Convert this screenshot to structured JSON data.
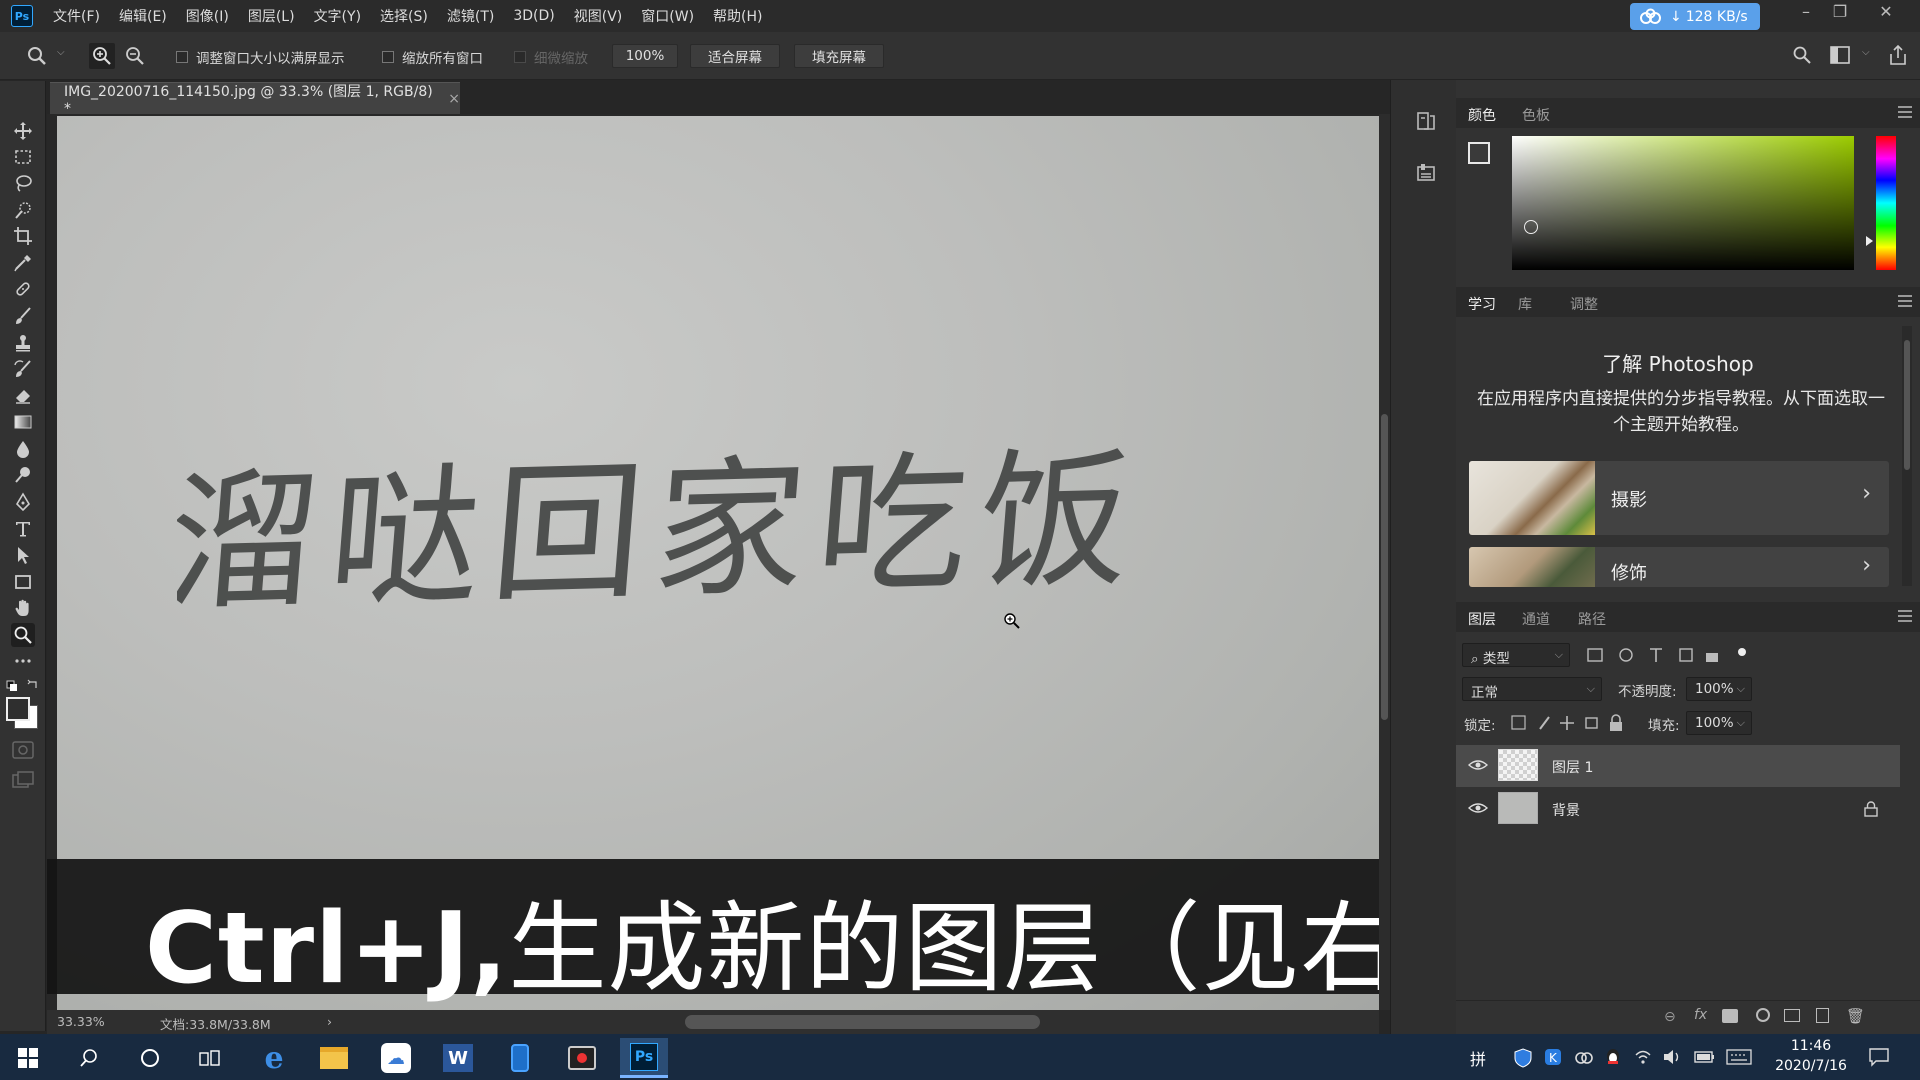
{
  "menubar": {
    "app_icon": "Ps",
    "items": [
      "文件(F)",
      "编辑(E)",
      "图像(I)",
      "图层(L)",
      "文字(Y)",
      "选择(S)",
      "滤镜(T)",
      "3D(D)",
      "视图(V)",
      "窗口(W)",
      "帮助(H)"
    ],
    "net_speed": "128 KB/s"
  },
  "options": {
    "resize_window": "调整窗口大小以满屏显示",
    "zoom_all": "缩放所有窗口",
    "scrubby_zoom": "细微缩放",
    "zoom_value": "100%",
    "fit_screen": "适合屏幕",
    "fill_screen": "填充屏幕"
  },
  "document": {
    "tab_title": "IMG_20200716_114150.jpg @ 33.3% (图层 1, RGB/8) *",
    "close": "×",
    "subtitle_latin": "Ctrl+J,",
    "subtitle_cjk": "生成新的图层（见右下角）",
    "handwriting": "溜哒回家吃饭"
  },
  "status": {
    "zoom": "33.33%",
    "doc_size": "文档:33.8M/33.8M",
    "arrow": "›"
  },
  "color_panel": {
    "tabs": [
      "颜色",
      "色板"
    ]
  },
  "learn_panel": {
    "tabs": [
      "学习",
      "库",
      "调整"
    ],
    "title": "了解 Photoshop",
    "description": "在应用程序内直接提供的分步指导教程。从下面选取一个主题开始教程。",
    "cards": [
      "摄影",
      "修饰"
    ]
  },
  "layers_panel": {
    "tabs": [
      "图层",
      "通道",
      "路径"
    ],
    "filter_kind": "类型",
    "blend_mode": "正常",
    "opacity_label": "不透明度:",
    "opacity_value": "100%",
    "lock_label": "锁定:",
    "fill_label": "填充:",
    "fill_value": "100%",
    "layers": [
      {
        "name": "图层 1",
        "selected": true
      },
      {
        "name": "背景",
        "locked": true
      }
    ]
  },
  "taskbar": {
    "time": "11:46",
    "date": "2020/7/16",
    "ime": "拼"
  },
  "colors": {
    "accent_blue": "#31a8ff",
    "taskbar": "#182a40",
    "net_badge": "#5aa0ea"
  }
}
